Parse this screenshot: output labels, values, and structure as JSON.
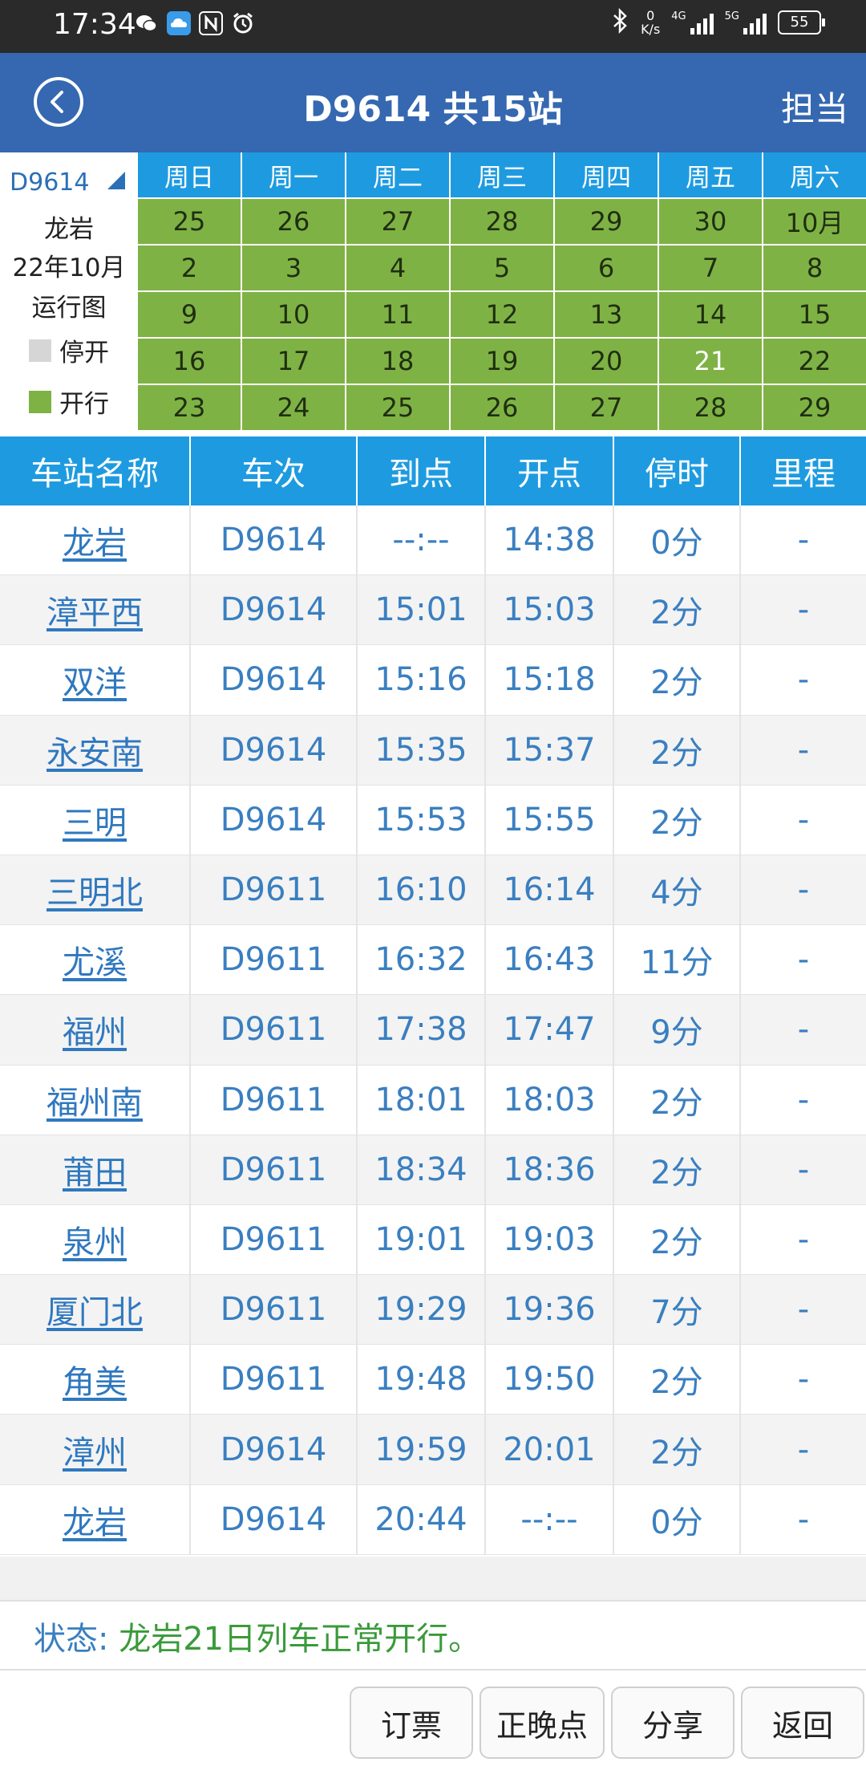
{
  "status_bar": {
    "time": "17:34",
    "net_speed_value": "0",
    "net_speed_unit": "K/s",
    "signal1_tag": "4G",
    "signal2_tag": "5G",
    "battery": "55",
    "notif_icons": [
      "wechat-icon",
      "cloud-icon",
      "nfc-icon",
      "alarm-icon"
    ]
  },
  "header": {
    "title": "D9614  共15站",
    "right_label": "担当"
  },
  "calendar": {
    "train": "D9614",
    "station": "龙岩",
    "month": "22年10月",
    "caption": "运行图",
    "legend_stop": "停开",
    "legend_run": "开行",
    "colors": {
      "run": "#7fb245",
      "stop": "#d6d6d6",
      "header": "#1e9be0"
    },
    "weekdays": [
      "周日",
      "周一",
      "周二",
      "周三",
      "周四",
      "周五",
      "周六"
    ],
    "weeks": [
      [
        "25",
        "26",
        "27",
        "28",
        "29",
        "30",
        "10月"
      ],
      [
        "2",
        "3",
        "4",
        "5",
        "6",
        "7",
        "8"
      ],
      [
        "9",
        "10",
        "11",
        "12",
        "13",
        "14",
        "15"
      ],
      [
        "16",
        "17",
        "18",
        "19",
        "20",
        "21",
        "22"
      ],
      [
        "23",
        "24",
        "25",
        "26",
        "27",
        "28",
        "29"
      ]
    ],
    "highlight": "21"
  },
  "table": {
    "columns": [
      "车站名称",
      "车次",
      "到点",
      "开点",
      "停时",
      "里程"
    ],
    "rows": [
      [
        "龙岩",
        "D9614",
        "--:--",
        "14:38",
        "0分",
        "-"
      ],
      [
        "漳平西",
        "D9614",
        "15:01",
        "15:03",
        "2分",
        "-"
      ],
      [
        "双洋",
        "D9614",
        "15:16",
        "15:18",
        "2分",
        "-"
      ],
      [
        "永安南",
        "D9614",
        "15:35",
        "15:37",
        "2分",
        "-"
      ],
      [
        "三明",
        "D9614",
        "15:53",
        "15:55",
        "2分",
        "-"
      ],
      [
        "三明北",
        "D9611",
        "16:10",
        "16:14",
        "4分",
        "-"
      ],
      [
        "尤溪",
        "D9611",
        "16:32",
        "16:43",
        "11分",
        "-"
      ],
      [
        "福州",
        "D9611",
        "17:38",
        "17:47",
        "9分",
        "-"
      ],
      [
        "福州南",
        "D9611",
        "18:01",
        "18:03",
        "2分",
        "-"
      ],
      [
        "莆田",
        "D9611",
        "18:34",
        "18:36",
        "2分",
        "-"
      ],
      [
        "泉州",
        "D9611",
        "19:01",
        "19:03",
        "2分",
        "-"
      ],
      [
        "厦门北",
        "D9611",
        "19:29",
        "19:36",
        "7分",
        "-"
      ],
      [
        "角美",
        "D9611",
        "19:48",
        "19:50",
        "2分",
        "-"
      ],
      [
        "漳州",
        "D9614",
        "19:59",
        "20:01",
        "2分",
        "-"
      ],
      [
        "龙岩",
        "D9614",
        "20:44",
        "--:--",
        "0分",
        "-"
      ]
    ]
  },
  "status": {
    "label": "状态: ",
    "text": "龙岩21日列车正常开行。"
  },
  "buttons": {
    "book": "订票",
    "ontime": "正晚点",
    "share": "分享",
    "back": "返回"
  }
}
